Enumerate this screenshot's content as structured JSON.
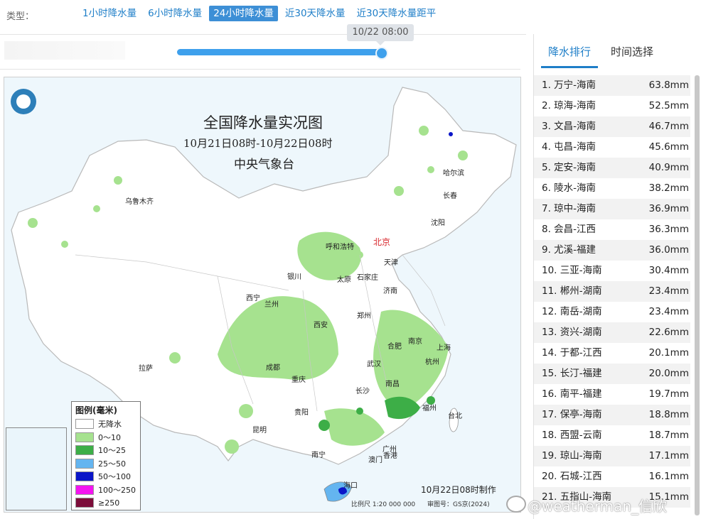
{
  "header": {
    "type_label": "类型：",
    "tabs": [
      {
        "label": "1小时降水量",
        "active": false
      },
      {
        "label": "6小时降水量",
        "active": false
      },
      {
        "label": "24小时降水量",
        "active": true
      },
      {
        "label": "近30天降水量",
        "active": false
      },
      {
        "label": "近30天降水量距平",
        "active": false
      }
    ]
  },
  "timeline": {
    "tooltip": "10/22 08:00",
    "progress": 1.0
  },
  "map": {
    "title": "全国降水量实况图",
    "subtitle": "10月21日08时-10月22日08时",
    "org": "中央气象台",
    "made": "10月22日08时制作",
    "scale": "比例尺 1:20 000 000",
    "audit": "审图号：GS京(2024)",
    "logo_icon": "cma-logo-icon",
    "legend": {
      "title": "图例(毫米)",
      "items": [
        {
          "label": "无降水",
          "color": "#ffffff"
        },
        {
          "label": "0～10",
          "color": "#a6e28f"
        },
        {
          "label": "10～25",
          "color": "#3dae47"
        },
        {
          "label": "25～50",
          "color": "#64b5f0"
        },
        {
          "label": "50～100",
          "color": "#0b16c8"
        },
        {
          "label": "100～250",
          "color": "#f414f0"
        },
        {
          "label": "≥250",
          "color": "#7c0d39"
        }
      ]
    },
    "cities": {
      "urumqi": "乌鲁木齐",
      "harbin": "哈尔滨",
      "changchun": "长春",
      "shenyang": "沈阳",
      "hohhot": "呼和浩特",
      "beijing": "北京",
      "tianjin": "天津",
      "yinchuan": "银川",
      "taiyuan": "太原",
      "shijiazhuang": "石家庄",
      "jinan": "济南",
      "xining": "西宁",
      "lanzhou": "兰州",
      "zhengzhou": "郑州",
      "xian": "西安",
      "nanjing": "南京",
      "hefei": "合肥",
      "shanghai": "上海",
      "lhasa": "拉萨",
      "chengdu": "成都",
      "wuhan": "武汉",
      "hangzhou": "杭州",
      "chongqing": "重庆",
      "nanchang": "南昌",
      "changsha": "长沙",
      "fuzhou": "福州",
      "guiyang": "贵阳",
      "kunming": "昆明",
      "taipei": "台北",
      "guangzhou": "广州",
      "nanning": "南宁",
      "hongkong": "香港",
      "macau": "澳门",
      "haikou": "海口"
    }
  },
  "panel": {
    "tabs": [
      {
        "label": "降水排行",
        "active": true
      },
      {
        "label": "时间选择",
        "active": false
      }
    ],
    "ranking": [
      {
        "name": "1. 万宁-海南",
        "value": "63.8mm"
      },
      {
        "name": "2. 琼海-海南",
        "value": "52.5mm"
      },
      {
        "name": "3. 文昌-海南",
        "value": "46.7mm"
      },
      {
        "name": "4. 屯昌-海南",
        "value": "45.6mm"
      },
      {
        "name": "5. 定安-海南",
        "value": "40.9mm"
      },
      {
        "name": "6. 陵水-海南",
        "value": "38.2mm"
      },
      {
        "name": "7. 琼中-海南",
        "value": "36.9mm"
      },
      {
        "name": "8. 会昌-江西",
        "value": "36.3mm"
      },
      {
        "name": "9. 尤溪-福建",
        "value": "36.0mm"
      },
      {
        "name": "10. 三亚-海南",
        "value": "30.4mm"
      },
      {
        "name": "11. 郴州-湖南",
        "value": "23.4mm"
      },
      {
        "name": "12. 南岳-湖南",
        "value": "23.4mm"
      },
      {
        "name": "13. 资兴-湖南",
        "value": "22.6mm"
      },
      {
        "name": "14. 于都-江西",
        "value": "20.1mm"
      },
      {
        "name": "15. 长汀-福建",
        "value": "20.0mm"
      },
      {
        "name": "16. 南平-福建",
        "value": "19.7mm"
      },
      {
        "name": "17. 保亭-海南",
        "value": "18.8mm"
      },
      {
        "name": "18. 西盟-云南",
        "value": "18.7mm"
      },
      {
        "name": "19. 琼山-海南",
        "value": "17.1mm"
      },
      {
        "name": "20. 石城-江西",
        "value": "16.1mm"
      },
      {
        "name": "21. 五指山-海南",
        "value": "15.1mm"
      }
    ]
  },
  "watermark": "@weatherman_信欣"
}
